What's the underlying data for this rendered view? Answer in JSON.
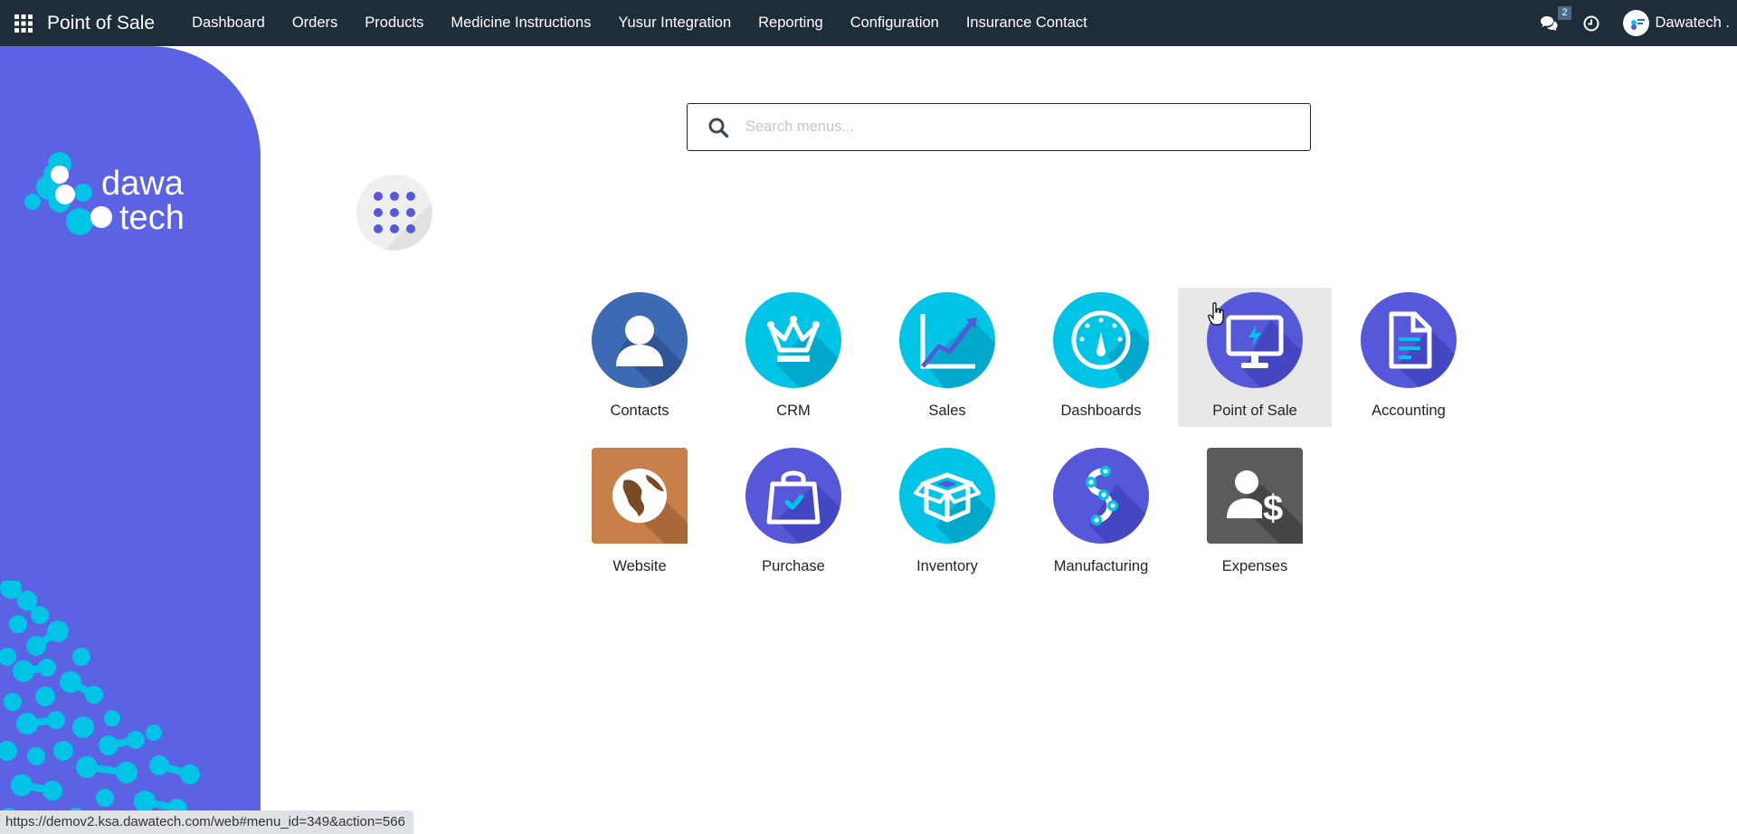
{
  "navbar": {
    "brand": "Point of Sale",
    "menu": [
      "Dashboard",
      "Orders",
      "Products",
      "Medicine Instructions",
      "Yusur Integration",
      "Reporting",
      "Configuration",
      "Insurance Contact"
    ],
    "messages_count": "2",
    "user_name": "Dawatech ."
  },
  "sidebar": {
    "logo_line1": "dawa",
    "logo_line2": "tech"
  },
  "search": {
    "placeholder": "Search menus..."
  },
  "apps": [
    {
      "label": "Contacts",
      "icon": "contacts-icon"
    },
    {
      "label": "CRM",
      "icon": "crown-icon"
    },
    {
      "label": "Sales",
      "icon": "sales-chart-icon"
    },
    {
      "label": "Dashboards",
      "icon": "gauge-icon"
    },
    {
      "label": "Point of Sale",
      "icon": "monitor-icon"
    },
    {
      "label": "Accounting",
      "icon": "document-icon"
    },
    {
      "label": "Website",
      "icon": "globe-icon"
    },
    {
      "label": "Purchase",
      "icon": "shopping-bag-icon"
    },
    {
      "label": "Inventory",
      "icon": "box-icon"
    },
    {
      "label": "Manufacturing",
      "icon": "nodes-icon"
    },
    {
      "label": "Expenses",
      "icon": "person-dollar-icon"
    }
  ],
  "active_app": "Point of Sale",
  "status_url": "https://demov2.ksa.dawatech.com/web#menu_id=349&action=566",
  "colors": {
    "navbar": "#1f2d3a",
    "panel": "#5b62e3",
    "cyan": "#00c4e6",
    "indigo": "#5558d9",
    "steel_blue": "#3d6bb3"
  }
}
